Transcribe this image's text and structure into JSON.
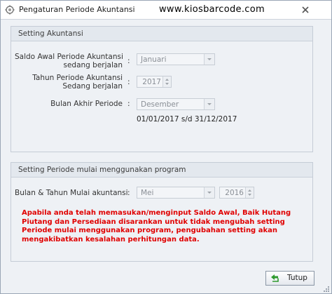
{
  "window": {
    "title": "Pengaturan Periode Akuntansi",
    "watermark": "www.kiosbarcode.com"
  },
  "setting_akuntansi": {
    "title": "Setting Akuntansi",
    "saldo_awal_label_line1": "Saldo Awal Periode Akuntansi",
    "saldo_awal_label_line2": "sedang berjalan",
    "saldo_awal_value": "Januari",
    "tahun_label_line1": "Tahun Periode Akuntansi",
    "tahun_label_line2": "Sedang berjalan",
    "tahun_value": "2017",
    "bulan_akhir_label": "Bulan Akhir Periode",
    "bulan_akhir_value": "Desember",
    "range_text": "01/01/2017 s/d 31/12/2017"
  },
  "setting_periode": {
    "title": "Setting Periode mulai menggunakan program",
    "bulan_tahun_label": "Bulan & Tahun Mulai akuntansi",
    "bulan_value": "Mei",
    "tahun_value": "2016"
  },
  "colon": ":",
  "warning_text": "Apabila anda telah memasukan/menginput Saldo Awal, Baik Hutang Piutang dan Persediaan disarankan untuk tidak mengubah setting Periode mulai menggunakan program, pengubahan setting akan mengakibatkan kesalahan perhitungan data.",
  "buttons": {
    "tutup": "Tutup"
  },
  "colors": {
    "warning": "#e00000",
    "button_icon": "#2e9a2e"
  }
}
